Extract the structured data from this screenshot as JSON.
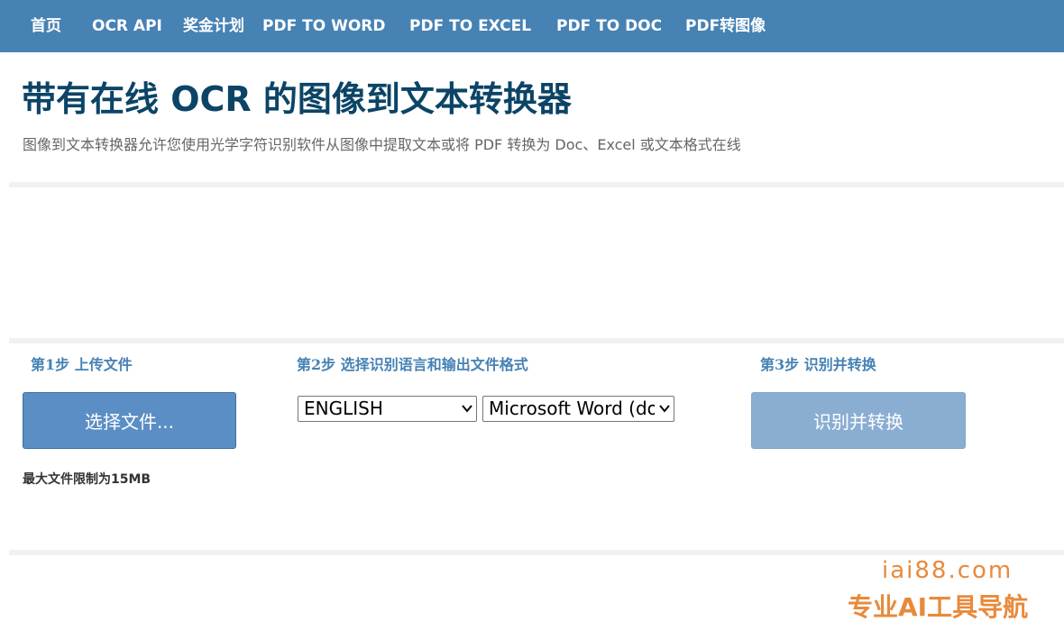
{
  "nav": {
    "home": "首页",
    "ocr_api": "OCR API",
    "bonus": "奖金计划",
    "pdf_to_word": "PDF TO WORD",
    "pdf_to_excel": "PDF TO EXCEL",
    "pdf_to_doc": "PDF TO DOC",
    "pdf_to_image": "PDF转图像"
  },
  "header": {
    "title": "带有在线 OCR 的图像到文本转换器",
    "subtitle": "图像到文本转换器允许您使用光学字符识别软件从图像中提取文本或将 PDF 转换为 Doc、Excel 或文本格式在线"
  },
  "step1": {
    "label": "第1步 上传文件",
    "button": "选择文件...",
    "limit": "最大文件限制为15MB"
  },
  "step2": {
    "label": "第2步 选择识别语言和输出文件格式",
    "language": "ENGLISH",
    "format": "Microsoft Word (docx)"
  },
  "step3": {
    "label": "第3步 识别并转换",
    "button": "识别并转换"
  },
  "watermark": {
    "site": "iai88.com",
    "tagline": "专业AI工具导航"
  },
  "colors": {
    "navbar": "#4682b4",
    "title": "#0b4466",
    "upload_button": "#5b8ec4",
    "convert_button": "#8aaed2",
    "watermark": "#e88a3c"
  }
}
